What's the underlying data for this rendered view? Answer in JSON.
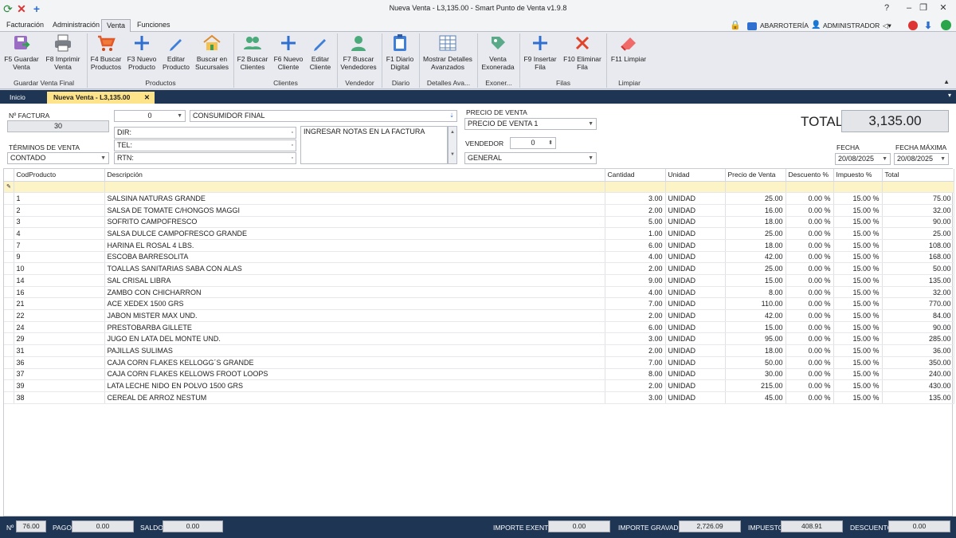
{
  "window": {
    "title": "Nueva Venta - L3,135.00 - Smart Punto de Venta v1.9.8"
  },
  "menu": {
    "tabs": [
      "Facturación",
      "Administración",
      "Venta",
      "Funciones"
    ],
    "store": "ABARROTERÍA",
    "user": "ADMINISTRADOR"
  },
  "ribbon": {
    "buttons": [
      {
        "l1": "F5 Guardar",
        "l2": "Venta"
      },
      {
        "l1": "F8 Imprimir",
        "l2": "Venta"
      },
      {
        "l1": "F4 Buscar",
        "l2": "Productos"
      },
      {
        "l1": "F3 Nuevo",
        "l2": "Producto"
      },
      {
        "l1": "Editar",
        "l2": "Producto"
      },
      {
        "l1": "Buscar en",
        "l2": "Sucursales"
      },
      {
        "l1": "F2 Buscar",
        "l2": "Clientes"
      },
      {
        "l1": "F6 Nuevo",
        "l2": "Cliente"
      },
      {
        "l1": "Editar",
        "l2": "Cliente"
      },
      {
        "l1": "F7 Buscar",
        "l2": "Vendedores"
      },
      {
        "l1": "F1 Diario",
        "l2": "Digital"
      },
      {
        "l1": "Mostrar Detalles",
        "l2": "Avanzados"
      },
      {
        "l1": "Venta",
        "l2": "Exonerada"
      },
      {
        "l1": "F9 Insertar",
        "l2": "Fila"
      },
      {
        "l1": "F10 Eliminar",
        "l2": "Fila"
      },
      {
        "l1": "F11 Limpiar",
        "l2": ""
      }
    ],
    "groups": [
      "Guardar Venta Final",
      "Productos",
      "Clientes",
      "Vendedor",
      "Diario",
      "Detalles Ava...",
      "Exoner...",
      "Filas",
      "Limpiar"
    ]
  },
  "doctabs": {
    "home": "Inicio",
    "active": "Nueva Venta - L3,135.00"
  },
  "form": {
    "factura_label": "Nº FACTURA",
    "factura_value": "30",
    "client_code": "0",
    "client_name": "CONSUMIDOR FINAL",
    "dir_label": "DIR:",
    "tel_label": "TEL:",
    "rtn_label": "RTN:",
    "notes_placeholder": "INGRESAR NOTAS EN LA FACTURA",
    "terminos_label": "TÉRMINOS DE VENTA",
    "terminos_value": "CONTADO",
    "precio_label": "PRECIO DE VENTA",
    "precio_value": "PRECIO DE VENTA 1",
    "vendedor_label": "VENDEDOR",
    "vendedor_code": "0",
    "vendedor_value": "GENERAL",
    "total_label": "TOTAL",
    "total_value": "3,135.00",
    "fecha_label": "FECHA",
    "fecha_value": "20/08/2025",
    "fecha_max_label": "FECHA MÁXIMA",
    "fecha_max_value": "20/08/2025"
  },
  "grid": {
    "columns": [
      "CodProducto",
      "Descripción",
      "Cantidad",
      "Unidad",
      "Precio de Venta",
      "Descuento %",
      "Impuesto %",
      "Total"
    ],
    "rows": [
      [
        "1",
        "SALSINA NATURAS GRANDE",
        "3.00",
        "UNIDAD",
        "25.00",
        "0.00 %",
        "15.00 %",
        "75.00"
      ],
      [
        "2",
        "SALSA DE TOMATE C/HONGOS MAGGI",
        "2.00",
        "UNIDAD",
        "16.00",
        "0.00 %",
        "15.00 %",
        "32.00"
      ],
      [
        "3",
        "SOFRITO CAMPOFRESCO",
        "5.00",
        "UNIDAD",
        "18.00",
        "0.00 %",
        "15.00 %",
        "90.00"
      ],
      [
        "4",
        "SALSA DULCE CAMPOFRESCO GRANDE",
        "1.00",
        "UNIDAD",
        "25.00",
        "0.00 %",
        "15.00 %",
        "25.00"
      ],
      [
        "7",
        "HARINA EL ROSAL 4 LBS.",
        "6.00",
        "UNIDAD",
        "18.00",
        "0.00 %",
        "15.00 %",
        "108.00"
      ],
      [
        "9",
        "ESCOBA BARRESOLITA",
        "4.00",
        "UNIDAD",
        "42.00",
        "0.00 %",
        "15.00 %",
        "168.00"
      ],
      [
        "10",
        "TOALLAS SANITARIAS SABA CON ALAS",
        "2.00",
        "UNIDAD",
        "25.00",
        "0.00 %",
        "15.00 %",
        "50.00"
      ],
      [
        "14",
        "SAL CRISAL LIBRA",
        "9.00",
        "UNIDAD",
        "15.00",
        "0.00 %",
        "15.00 %",
        "135.00"
      ],
      [
        "16",
        "ZAMBO CON CHICHARRON",
        "4.00",
        "UNIDAD",
        "8.00",
        "0.00 %",
        "15.00 %",
        "32.00"
      ],
      [
        "21",
        "ACE XEDEX 1500 GRS",
        "7.00",
        "UNIDAD",
        "110.00",
        "0.00 %",
        "15.00 %",
        "770.00"
      ],
      [
        "22",
        "JABON MISTER MAX UND.",
        "2.00",
        "UNIDAD",
        "42.00",
        "0.00 %",
        "15.00 %",
        "84.00"
      ],
      [
        "24",
        "PRESTOBARBA GILLETE",
        "6.00",
        "UNIDAD",
        "15.00",
        "0.00 %",
        "15.00 %",
        "90.00"
      ],
      [
        "29",
        "JUGO EN LATA DEL MONTE UND.",
        "3.00",
        "UNIDAD",
        "95.00",
        "0.00 %",
        "15.00 %",
        "285.00"
      ],
      [
        "31",
        "PAJILLAS SULIMAS",
        "2.00",
        "UNIDAD",
        "18.00",
        "0.00 %",
        "15.00 %",
        "36.00"
      ],
      [
        "36",
        "CAJA CORN FLAKES KELLOGG´S GRANDE",
        "7.00",
        "UNIDAD",
        "50.00",
        "0.00 %",
        "15.00 %",
        "350.00"
      ],
      [
        "37",
        "CAJA CORN FLAKES KELLOWS FROOT LOOPS",
        "8.00",
        "UNIDAD",
        "30.00",
        "0.00 %",
        "15.00 %",
        "240.00"
      ],
      [
        "39",
        "LATA LECHE NIDO EN POLVO 1500 GRS",
        "2.00",
        "UNIDAD",
        "215.00",
        "0.00 %",
        "15.00 %",
        "430.00"
      ],
      [
        "38",
        "CEREAL DE ARROZ NESTUM",
        "3.00",
        "UNIDAD",
        "45.00",
        "0.00 %",
        "15.00 %",
        "135.00"
      ]
    ]
  },
  "status": {
    "n_label": "Nº",
    "n_value": "76.00",
    "pago_label": "PAGO",
    "pago_value": "0.00",
    "saldo_label": "SALDO",
    "saldo_value": "0.00",
    "exento_label": "IMPORTE EXENTO",
    "exento_value": "0.00",
    "gravado_label": "IMPORTE GRAVADO",
    "gravado_value": "2,726.09",
    "impuesto_label": "IMPUESTO",
    "impuesto_value": "408.91",
    "descuento_label": "DESCUENTO",
    "descuento_value": "0.00"
  },
  "colors": {
    "accent": "#1f3554",
    "active_tab": "#fde38a",
    "new_row": "#fcf3c6"
  }
}
